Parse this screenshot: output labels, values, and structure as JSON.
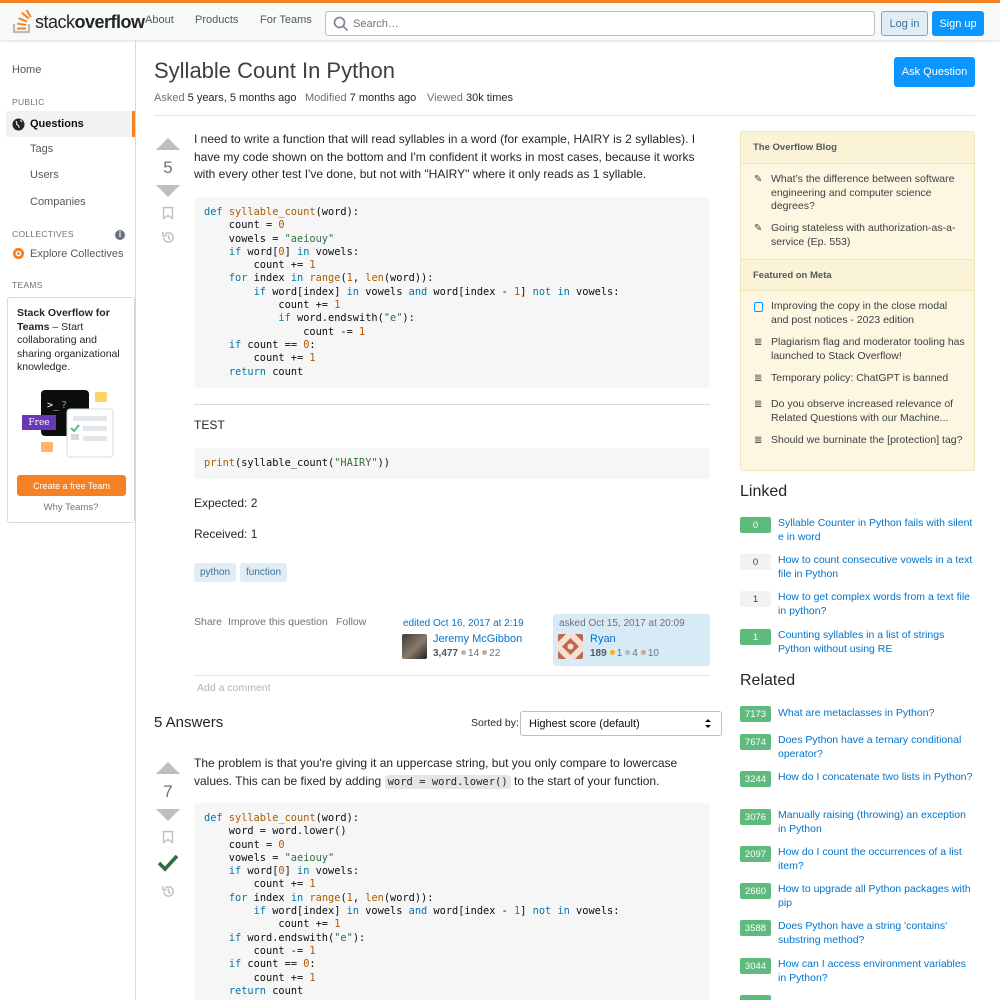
{
  "header": {
    "logo_light": "stack",
    "logo_bold": "overflow",
    "nav": [
      "About",
      "Products",
      "For Teams"
    ],
    "search_placeholder": "Search…",
    "login": "Log in",
    "signup": "Sign up"
  },
  "leftnav": {
    "home": "Home",
    "public_head": "PUBLIC",
    "questions": "Questions",
    "tags": "Tags",
    "users": "Users",
    "companies": "Companies",
    "collectives_head": "COLLECTIVES",
    "explore_collectives": "Explore Collectives",
    "teams_head": "TEAMS",
    "teams_title": "Stack Overflow for Teams",
    "teams_desc": " – Start collaborating and sharing organizational knowledge.",
    "free_label": "Free",
    "create_team": "Create a free Team",
    "why_teams": "Why Teams?"
  },
  "question": {
    "title": "Syllable Count In Python",
    "ask_button": "Ask Question",
    "asked_label": "Asked",
    "asked_value": "5 years, 5 months ago",
    "modified_label": "Modified",
    "modified_value": "7 months ago",
    "viewed_label": "Viewed",
    "viewed_value": "30k times",
    "votes": "5",
    "body": "I need to write a function that will read syllables in a word (for example, HAIRY is 2 syllables). I have my code shown on the bottom and I'm confident it works in most cases, because it works with every other test I've done, but not with \"HAIRY\" where it only reads as 1 syllable.",
    "test_label": "TEST",
    "expected": "Expected: 2",
    "received": "Received: 1",
    "tags": [
      "python",
      "function"
    ],
    "share": "Share",
    "improve": "Improve this question",
    "follow": "Follow",
    "edited_text": "edited Oct 16, 2017 at 2:19",
    "editor_name": "Jeremy McGibbon",
    "editor_rep": "3,477",
    "editor_silver": "14",
    "editor_bronze": "22",
    "asked_text": "asked Oct 15, 2017 at 20:09",
    "asker_name": "Ryan",
    "asker_rep": "189",
    "asker_gold": "1",
    "asker_silver": "4",
    "asker_bronze": "10",
    "add_comment": "Add a comment"
  },
  "answers": {
    "count_label": "5 Answers",
    "sorted_label": "Sorted by:",
    "sort_value": "Highest score (default)",
    "first": {
      "votes": "7",
      "text_before": "The problem is that you're giving it an uppercase string, but you only compare to lowercase values. This can be fixed by adding ",
      "inline_code": "word = word.lower()",
      "text_after": " to the start of your function."
    }
  },
  "sidebar": {
    "blog_head": "The Overflow Blog",
    "blog_items": [
      "What’s the difference between software engineering and computer science degrees?",
      "Going stateless with authorization-as-a-service (Ep. 553)"
    ],
    "meta_head": "Featured on Meta",
    "meta_items": [
      "Improving the copy in the close modal and post notices - 2023 edition",
      "Plagiarism flag and moderator tooling has launched to Stack Overflow!",
      "Temporary policy: ChatGPT is banned",
      "Do you observe increased relevance of Related Questions with our Machine...",
      "Should we burninate the [protection] tag?"
    ],
    "linked_title": "Linked",
    "linked": [
      {
        "score": "0",
        "answered": true,
        "title": "Syllable Counter in Python fails with silent e in word"
      },
      {
        "score": "0",
        "answered": false,
        "title": "How to count consecutive vowels in a text file in Python"
      },
      {
        "score": "1",
        "answered": false,
        "title": "How to get complex words from a text file in python?"
      },
      {
        "score": "1",
        "answered": true,
        "title": "Counting syllables in a list of strings Python without using RE"
      }
    ],
    "related_title": "Related",
    "related": [
      {
        "score": "7173",
        "title": "What are metaclasses in Python?"
      },
      {
        "score": "7674",
        "title": "Does Python have a ternary conditional operator?"
      },
      {
        "score": "3244",
        "title": "How do I concatenate two lists in Python?"
      },
      {
        "score": "3076",
        "title": "Manually raising (throwing) an exception in Python"
      },
      {
        "score": "2097",
        "title": "How do I count the occurrences of a list item?"
      },
      {
        "score": "2660",
        "title": "How to upgrade all Python packages with pip"
      },
      {
        "score": "3588",
        "title": "Does Python have a string 'contains' substring method?"
      },
      {
        "score": "3044",
        "title": "How can I access environment variables in Python?"
      }
    ]
  },
  "colors": {
    "accent": "#f48225",
    "primary": "#0a95ff",
    "link": "#0074cc",
    "accepted": "#2f6f44"
  }
}
